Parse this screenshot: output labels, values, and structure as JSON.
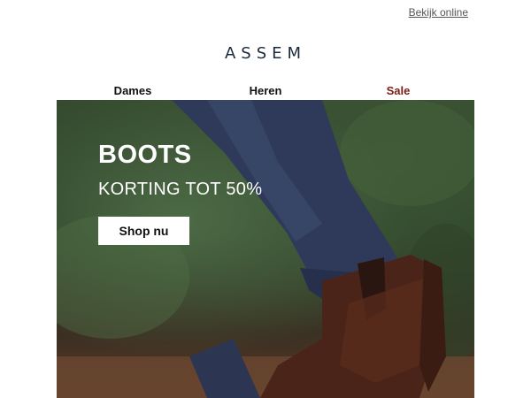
{
  "header": {
    "view_online": "Bekijk online",
    "logo": "ASSEM"
  },
  "nav": {
    "items": [
      {
        "label": "Dames"
      },
      {
        "label": "Heren"
      },
      {
        "label": "Sale",
        "color": "#7a1d14"
      }
    ]
  },
  "hero": {
    "title": "BOOTS",
    "subtitle": "KORTING TOT 50%",
    "cta_label": "Shop nu"
  }
}
